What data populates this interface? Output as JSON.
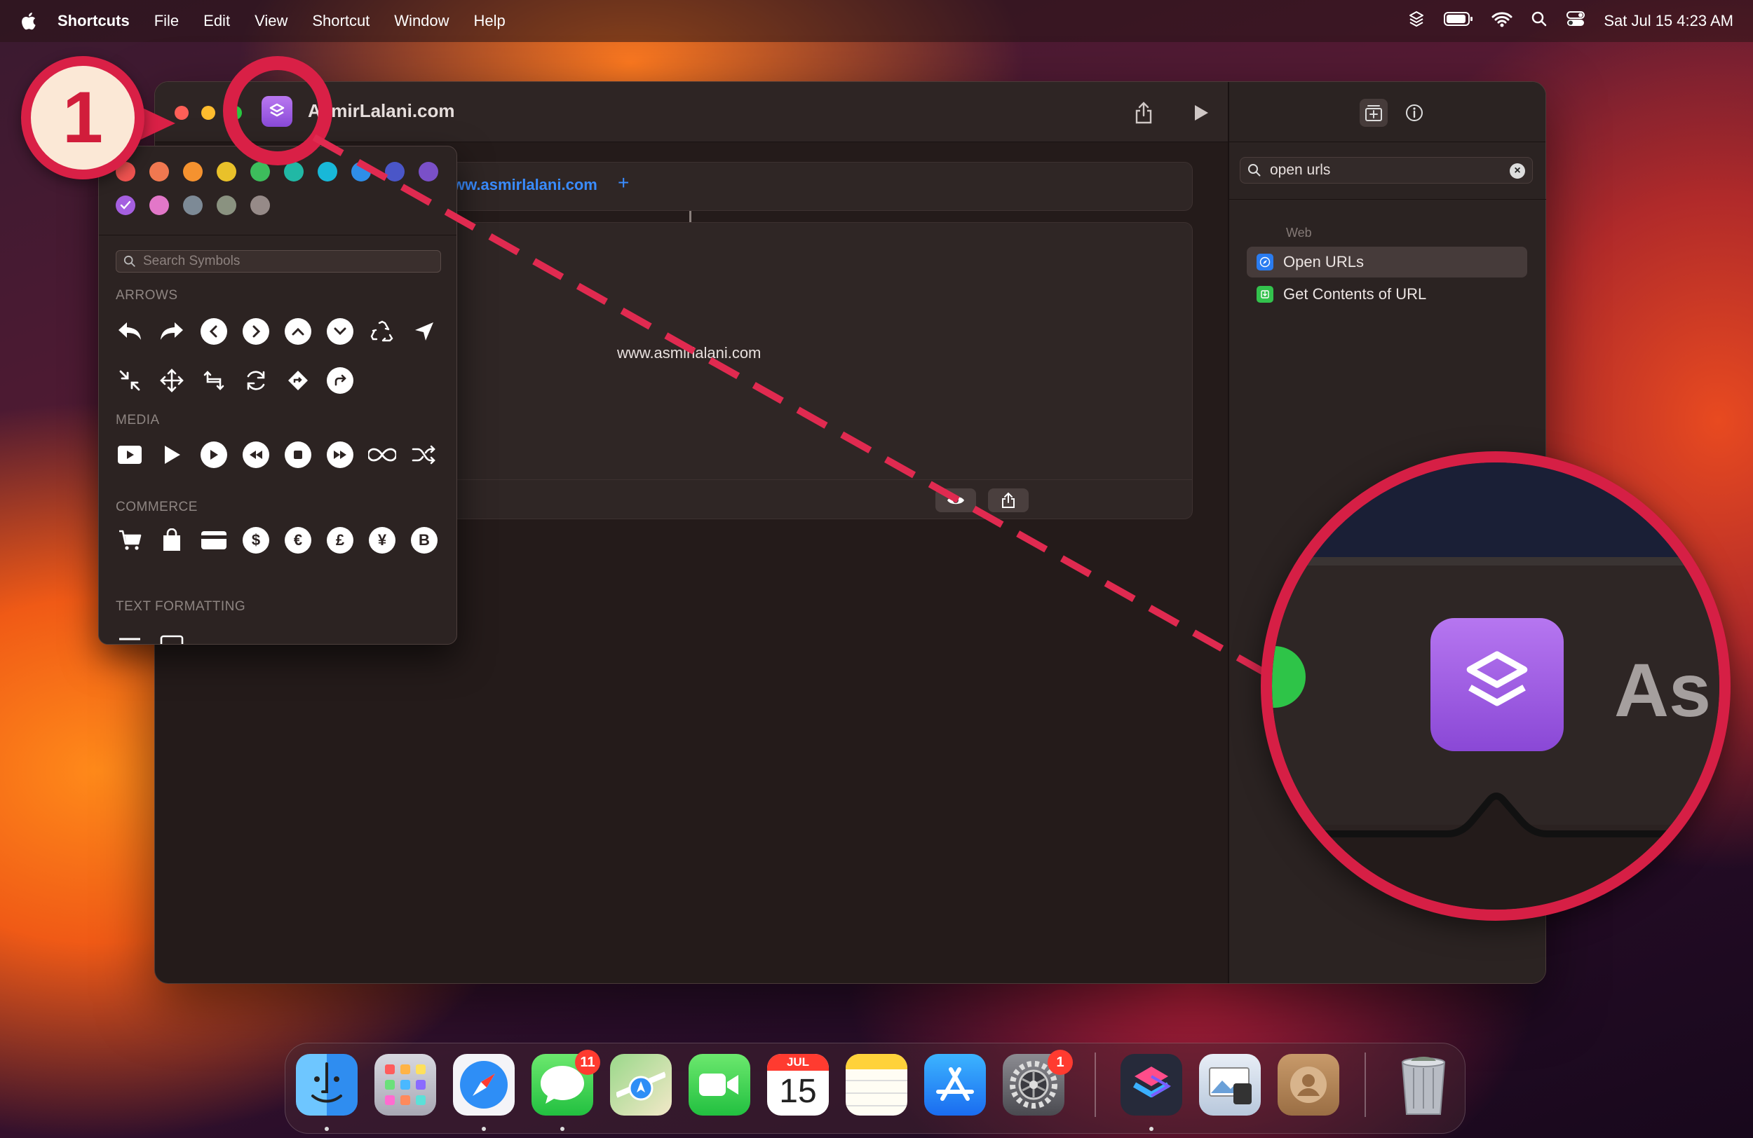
{
  "menubar": {
    "app_name": "Shortcuts",
    "items": [
      "File",
      "Edit",
      "View",
      "Shortcut",
      "Window",
      "Help"
    ],
    "clock": "Sat Jul 15  4:23 AM"
  },
  "window": {
    "title": "AsmirLalani.com"
  },
  "editor": {
    "url_value": "www.asmirlalani.com",
    "url_link_visible": "ww.asmirlalani.com",
    "plus_label": "+",
    "result_text": "www.asmirlalani.com"
  },
  "popover": {
    "search_placeholder": "Search Symbols",
    "sections": [
      "ARROWS",
      "MEDIA",
      "COMMERCE",
      "TEXT FORMATTING"
    ],
    "selected_color": "#a55fe0",
    "commerce_glyphs": [
      "$",
      "€",
      "£",
      "¥",
      "B"
    ]
  },
  "sidebar": {
    "search_value": "open urls",
    "category": "Web",
    "results": [
      {
        "label": "Open URLs",
        "selected": true
      },
      {
        "label": "Get Contents of URL",
        "selected": false
      }
    ]
  },
  "annotation": {
    "step_number": "1",
    "zoom_text": "As",
    "accent_color": "#d61f45"
  },
  "dock": {
    "apps": [
      "Finder",
      "Launchpad",
      "Safari",
      "Messages",
      "Maps",
      "FaceTime",
      "Calendar",
      "Notes",
      "App Store",
      "System Settings",
      "Shortcuts",
      "Preview",
      "Contacts",
      "Trash"
    ],
    "messages_badge": "11",
    "settings_badge": "1",
    "calendar_month": "JUL",
    "calendar_day": "15"
  }
}
